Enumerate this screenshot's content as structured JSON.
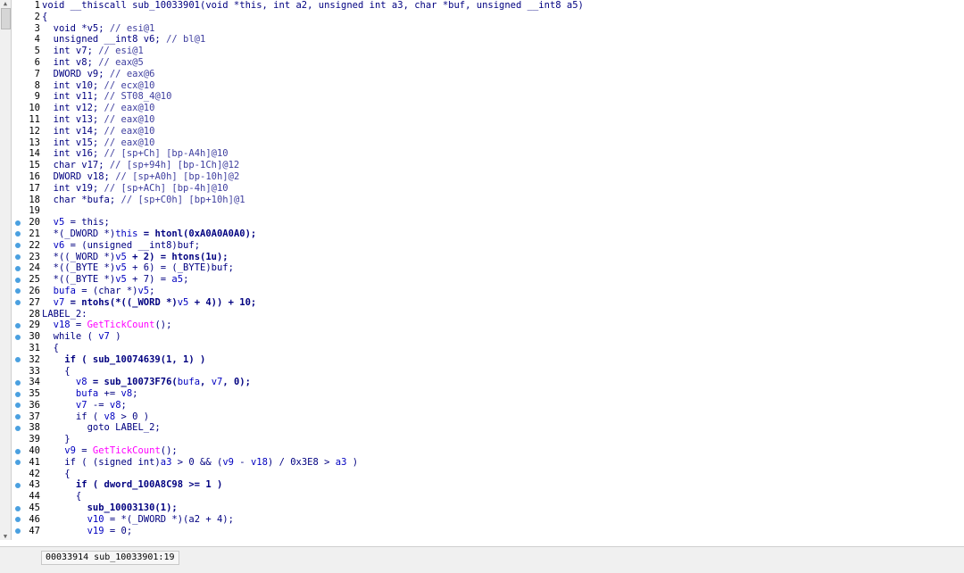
{
  "status": "00033914 sub_10033901:19",
  "code_lines": [
    {
      "n": "1",
      "dot": false,
      "parts": [
        {
          "t": "void __thiscall sub_10033901(void *this, int a2, unsigned int a3, char *buf, unsigned __int8 a5)",
          "c": "kw"
        }
      ]
    },
    {
      "n": "2",
      "dot": false,
      "parts": [
        {
          "t": "{",
          "c": "kw"
        }
      ]
    },
    {
      "n": "3",
      "dot": false,
      "parts": [
        {
          "t": "  void *v5; ",
          "c": "kw"
        },
        {
          "t": "// esi@1",
          "c": "cm"
        }
      ]
    },
    {
      "n": "4",
      "dot": false,
      "parts": [
        {
          "t": "  unsigned __int8 v6; ",
          "c": "kw"
        },
        {
          "t": "// bl@1",
          "c": "cm"
        }
      ]
    },
    {
      "n": "5",
      "dot": false,
      "parts": [
        {
          "t": "  int v7; ",
          "c": "kw"
        },
        {
          "t": "// esi@1",
          "c": "cm"
        }
      ]
    },
    {
      "n": "6",
      "dot": false,
      "parts": [
        {
          "t": "  int v8; ",
          "c": "kw"
        },
        {
          "t": "// eax@5",
          "c": "cm"
        }
      ]
    },
    {
      "n": "7",
      "dot": false,
      "parts": [
        {
          "t": "  DWORD v9; ",
          "c": "kw"
        },
        {
          "t": "// eax@6",
          "c": "cm"
        }
      ]
    },
    {
      "n": "8",
      "dot": false,
      "parts": [
        {
          "t": "  int v10; ",
          "c": "kw"
        },
        {
          "t": "// ecx@10",
          "c": "cm"
        }
      ]
    },
    {
      "n": "9",
      "dot": false,
      "parts": [
        {
          "t": "  int v11; ",
          "c": "kw"
        },
        {
          "t": "// ST08_4@10",
          "c": "cm"
        }
      ]
    },
    {
      "n": "10",
      "dot": false,
      "parts": [
        {
          "t": "  int v12; ",
          "c": "kw"
        },
        {
          "t": "// eax@10",
          "c": "cm"
        }
      ]
    },
    {
      "n": "11",
      "dot": false,
      "parts": [
        {
          "t": "  int v13; ",
          "c": "kw"
        },
        {
          "t": "// eax@10",
          "c": "cm"
        }
      ]
    },
    {
      "n": "12",
      "dot": false,
      "parts": [
        {
          "t": "  int v14; ",
          "c": "kw"
        },
        {
          "t": "// eax@10",
          "c": "cm"
        }
      ]
    },
    {
      "n": "13",
      "dot": false,
      "parts": [
        {
          "t": "  int v15; ",
          "c": "kw"
        },
        {
          "t": "// eax@10",
          "c": "cm"
        }
      ]
    },
    {
      "n": "14",
      "dot": false,
      "parts": [
        {
          "t": "  int v16; ",
          "c": "kw"
        },
        {
          "t": "// [sp+Ch] [bp-A4h]@10",
          "c": "cm"
        }
      ]
    },
    {
      "n": "15",
      "dot": false,
      "parts": [
        {
          "t": "  char v17; ",
          "c": "kw"
        },
        {
          "t": "// [sp+94h] [bp-1Ch]@12",
          "c": "cm"
        }
      ]
    },
    {
      "n": "16",
      "dot": false,
      "parts": [
        {
          "t": "  DWORD v18; ",
          "c": "kw"
        },
        {
          "t": "// [sp+A0h] [bp-10h]@2",
          "c": "cm"
        }
      ]
    },
    {
      "n": "17",
      "dot": false,
      "parts": [
        {
          "t": "  int v19; ",
          "c": "kw"
        },
        {
          "t": "// [sp+ACh] [bp-4h]@10",
          "c": "cm"
        }
      ]
    },
    {
      "n": "18",
      "dot": false,
      "parts": [
        {
          "t": "  char *bufa; ",
          "c": "kw"
        },
        {
          "t": "// [sp+C0h] [bp+10h]@1",
          "c": "cm"
        }
      ]
    },
    {
      "n": "19",
      "dot": false,
      "parts": [
        {
          "t": "",
          "c": "kw"
        }
      ]
    },
    {
      "n": "20",
      "dot": true,
      "parts": [
        {
          "t": "  v5",
          "c": "v"
        },
        {
          "t": " = this;",
          "c": "kw"
        }
      ]
    },
    {
      "n": "21",
      "dot": true,
      "parts": [
        {
          "t": "  *(_DWORD *)",
          "c": "kw"
        },
        {
          "t": "this",
          "c": "v"
        },
        {
          "t": " = htonl(0xA0A0A0A0);",
          "c": "fn"
        }
      ]
    },
    {
      "n": "22",
      "dot": true,
      "parts": [
        {
          "t": "  v6",
          "c": "v"
        },
        {
          "t": " = (unsigned __int8)buf;",
          "c": "kw"
        }
      ]
    },
    {
      "n": "23",
      "dot": true,
      "parts": [
        {
          "t": "  *((_WORD *)",
          "c": "kw"
        },
        {
          "t": "v5",
          "c": "v"
        },
        {
          "t": " + 2) = htons(1u);",
          "c": "fn"
        }
      ]
    },
    {
      "n": "24",
      "dot": true,
      "parts": [
        {
          "t": "  *((_BYTE *)",
          "c": "kw"
        },
        {
          "t": "v5",
          "c": "v"
        },
        {
          "t": " + 6) = (_BYTE)buf;",
          "c": "kw"
        }
      ]
    },
    {
      "n": "25",
      "dot": true,
      "parts": [
        {
          "t": "  *((_BYTE *)",
          "c": "kw"
        },
        {
          "t": "v5",
          "c": "v"
        },
        {
          "t": " + 7) = ",
          "c": "kw"
        },
        {
          "t": "a5",
          "c": "v"
        },
        {
          "t": ";",
          "c": "kw"
        }
      ]
    },
    {
      "n": "26",
      "dot": true,
      "parts": [
        {
          "t": "  bufa",
          "c": "v"
        },
        {
          "t": " = (char *)",
          "c": "kw"
        },
        {
          "t": "v5",
          "c": "v"
        },
        {
          "t": ";",
          "c": "kw"
        }
      ]
    },
    {
      "n": "27",
      "dot": true,
      "parts": [
        {
          "t": "  v7",
          "c": "v"
        },
        {
          "t": " = ntohs(*((_WORD *)",
          "c": "fn"
        },
        {
          "t": "v5",
          "c": "v"
        },
        {
          "t": " + 4)) + 10;",
          "c": "fn"
        }
      ]
    },
    {
      "n": "28",
      "dot": false,
      "parts": [
        {
          "t": "LABEL_2:",
          "c": "lbl"
        }
      ]
    },
    {
      "n": "29",
      "dot": true,
      "parts": [
        {
          "t": "  v18",
          "c": "v"
        },
        {
          "t": " = ",
          "c": "kw"
        },
        {
          "t": "GetTickCount",
          "c": "api"
        },
        {
          "t": "();",
          "c": "kw"
        }
      ]
    },
    {
      "n": "30",
      "dot": true,
      "parts": [
        {
          "t": "  while ( ",
          "c": "kw"
        },
        {
          "t": "v7",
          "c": "v"
        },
        {
          "t": " )",
          "c": "kw"
        }
      ]
    },
    {
      "n": "31",
      "dot": false,
      "parts": [
        {
          "t": "  {",
          "c": "kw"
        }
      ]
    },
    {
      "n": "32",
      "dot": true,
      "parts": [
        {
          "t": "    if ( sub_10074639(1, 1) )",
          "c": "fn"
        }
      ]
    },
    {
      "n": "33",
      "dot": false,
      "parts": [
        {
          "t": "    {",
          "c": "kw"
        }
      ]
    },
    {
      "n": "34",
      "dot": true,
      "parts": [
        {
          "t": "      v8",
          "c": "v"
        },
        {
          "t": " = sub_10073F76(",
          "c": "fn"
        },
        {
          "t": "bufa",
          "c": "v"
        },
        {
          "t": ", ",
          "c": "fn"
        },
        {
          "t": "v7",
          "c": "v"
        },
        {
          "t": ", 0);",
          "c": "fn"
        }
      ]
    },
    {
      "n": "35",
      "dot": true,
      "parts": [
        {
          "t": "      bufa",
          "c": "v"
        },
        {
          "t": " += ",
          "c": "kw"
        },
        {
          "t": "v8",
          "c": "v"
        },
        {
          "t": ";",
          "c": "kw"
        }
      ]
    },
    {
      "n": "36",
      "dot": true,
      "parts": [
        {
          "t": "      v7",
          "c": "v"
        },
        {
          "t": " -= ",
          "c": "kw"
        },
        {
          "t": "v8",
          "c": "v"
        },
        {
          "t": ";",
          "c": "kw"
        }
      ]
    },
    {
      "n": "37",
      "dot": true,
      "parts": [
        {
          "t": "      if ( ",
          "c": "kw"
        },
        {
          "t": "v8",
          "c": "v"
        },
        {
          "t": " > 0 )",
          "c": "kw"
        }
      ]
    },
    {
      "n": "38",
      "dot": true,
      "parts": [
        {
          "t": "        goto LABEL_2;",
          "c": "kw"
        }
      ]
    },
    {
      "n": "39",
      "dot": false,
      "parts": [
        {
          "t": "    }",
          "c": "kw"
        }
      ]
    },
    {
      "n": "40",
      "dot": true,
      "parts": [
        {
          "t": "    v9",
          "c": "v"
        },
        {
          "t": " = ",
          "c": "kw"
        },
        {
          "t": "GetTickCount",
          "c": "api"
        },
        {
          "t": "();",
          "c": "kw"
        }
      ]
    },
    {
      "n": "41",
      "dot": true,
      "parts": [
        {
          "t": "    if ( (signed int)",
          "c": "kw"
        },
        {
          "t": "a3",
          "c": "v"
        },
        {
          "t": " > 0 && (",
          "c": "kw"
        },
        {
          "t": "v9",
          "c": "v"
        },
        {
          "t": " - ",
          "c": "kw"
        },
        {
          "t": "v18",
          "c": "v"
        },
        {
          "t": ") / 0x3E8 > ",
          "c": "kw"
        },
        {
          "t": "a3",
          "c": "v"
        },
        {
          "t": " )",
          "c": "kw"
        }
      ]
    },
    {
      "n": "42",
      "dot": false,
      "parts": [
        {
          "t": "    {",
          "c": "kw"
        }
      ]
    },
    {
      "n": "43",
      "dot": true,
      "parts": [
        {
          "t": "      if ( dword_100A8C98 >= 1 )",
          "c": "fn"
        }
      ]
    },
    {
      "n": "44",
      "dot": false,
      "parts": [
        {
          "t": "      {",
          "c": "kw"
        }
      ]
    },
    {
      "n": "45",
      "dot": true,
      "parts": [
        {
          "t": "        sub_10003130(1);",
          "c": "fn"
        }
      ]
    },
    {
      "n": "46",
      "dot": true,
      "parts": [
        {
          "t": "        v10",
          "c": "v"
        },
        {
          "t": " = *(_DWORD *)(a2 + 4);",
          "c": "kw"
        }
      ]
    },
    {
      "n": "47",
      "dot": true,
      "parts": [
        {
          "t": "        v19",
          "c": "v"
        },
        {
          "t": " = 0;",
          "c": "kw"
        }
      ]
    }
  ]
}
